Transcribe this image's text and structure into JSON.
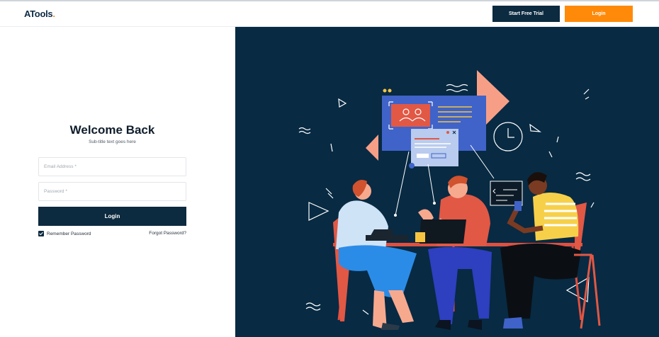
{
  "header": {
    "logo_text": "ATools",
    "logo_dot": ".",
    "start_trial_label": "Start Free Trial",
    "login_label": "Login"
  },
  "form": {
    "title": "Welcome Back",
    "subtitle": "Sub-title text goes here",
    "email_placeholder": "Email Address *",
    "password_placeholder": "Password *",
    "login_button_label": "Login",
    "remember_label": "Remember Password",
    "remember_checked": true,
    "forgot_label": "Forgot Password?"
  },
  "colors": {
    "navy": "#0c2a40",
    "accent_orange": "#ff8a0a",
    "illustration_bg": "#082a43"
  },
  "icons": {
    "checkbox": "check-icon"
  }
}
